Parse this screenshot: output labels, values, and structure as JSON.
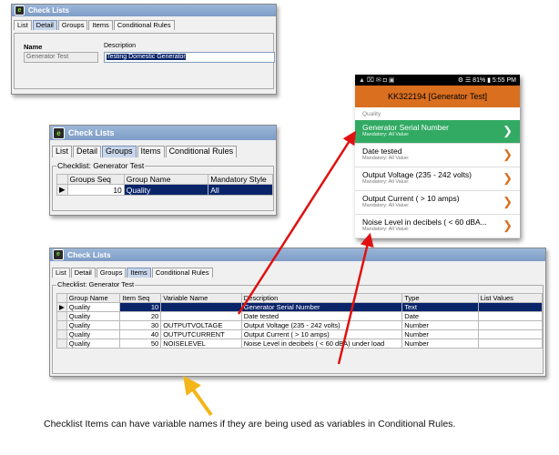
{
  "window1": {
    "title": "Check Lists",
    "tabs": [
      "List",
      "Detail",
      "Groups",
      "Items",
      "Conditional Rules"
    ],
    "name_label": "Name",
    "name_value": "Generator Test",
    "description_label": "Description",
    "description_value": "Testing Domestic Generator"
  },
  "window2": {
    "title": "Check Lists",
    "tabs": [
      "List",
      "Detail",
      "Groups",
      "Items",
      "Conditional Rules"
    ],
    "legend": "Checklist: Generator Test",
    "columns": [
      "Groups Seq",
      "Group Name",
      "Mandatory Style"
    ],
    "rows": [
      {
        "seq": "10",
        "group": "Quality",
        "style": "All"
      }
    ]
  },
  "window3": {
    "title": "Check Lists",
    "tabs": [
      "List",
      "Detail",
      "Groups",
      "Items",
      "Conditional Rules"
    ],
    "legend": "Checklist: Generator Test",
    "columns": [
      "Group Name",
      "Item Seq",
      "Variable Name",
      "Description",
      "Type",
      "List Values"
    ],
    "rows": [
      {
        "group": "Quality",
        "seq": "10",
        "var": "",
        "desc": "Generator Serial Number",
        "type": "Text",
        "list": ""
      },
      {
        "group": "Quality",
        "seq": "20",
        "var": "",
        "desc": "Date tested",
        "type": "Date",
        "list": ""
      },
      {
        "group": "Quality",
        "seq": "30",
        "var": "OUTPUTVOLTAGE",
        "desc": "Output Voltage (235 - 242 volts)",
        "type": "Number",
        "list": ""
      },
      {
        "group": "Quality",
        "seq": "40",
        "var": "OUTPUTCURRENT",
        "desc": "Output Current ( > 10 amps)",
        "type": "Number",
        "list": ""
      },
      {
        "group": "Quality",
        "seq": "50",
        "var": "NOISELEVEL",
        "desc": "Noise Level in decibels ( < 60 dBA) under load",
        "type": "Number",
        "list": ""
      }
    ]
  },
  "phone": {
    "status_left": "▲ ⌧ ✉ ◘ ▣",
    "status_right": "⚙ ☰ 81% ▮ 5:55 PM",
    "header": "KK322194 [Generator Test]",
    "section": "Quality",
    "items": [
      {
        "title": "Generator Serial Number",
        "sub": "Mandatory: All Value:"
      },
      {
        "title": "Date tested",
        "sub": "Mandatory: All Value:"
      },
      {
        "title": "Output Voltage (235 - 242 volts)",
        "sub": "Mandatory: All Value:"
      },
      {
        "title": "Output Current ( > 10 amps)",
        "sub": "Mandatory: All Value:"
      },
      {
        "title": "Noise Level in decibels ( < 60 dBA...",
        "sub": "Mandatory: All Value:"
      }
    ]
  },
  "caption": "Checklist Items can have variable names if they are being used as variables in Conditional Rules.",
  "colors": {
    "selection": "#0a246a",
    "phone_header": "#d96f1f",
    "phone_active": "#32aa64",
    "arrow_red": "#e01010",
    "arrow_yellow": "#f2b619"
  }
}
